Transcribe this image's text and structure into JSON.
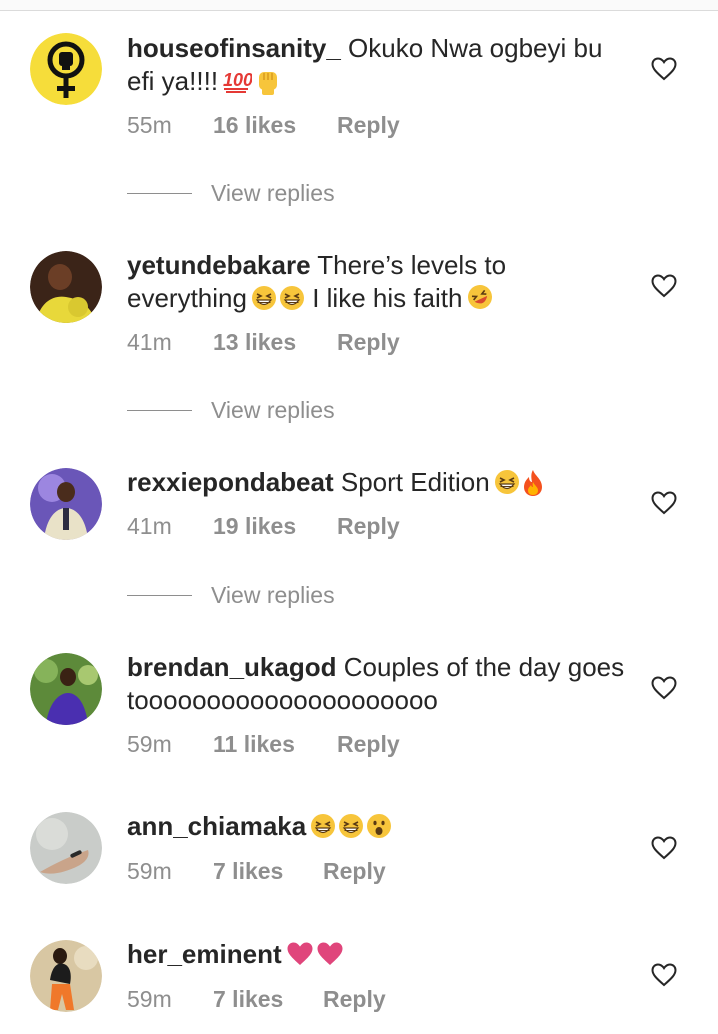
{
  "comments": [
    {
      "username": "houseofinsanity_",
      "text": " Okuko Nwa ogbeyi bu efi ya!!!!",
      "emojis": [
        "hundred-points-emoji",
        "raised-fist-emoji"
      ],
      "time": "55m",
      "likes": "16 likes",
      "reply": "Reply",
      "avatar_icon": "venus-fist-icon",
      "view_replies": "View replies"
    },
    {
      "username": "yetundebakare",
      "text": " There’s levels to everything",
      "emojis": [
        "grinning-squinting-emoji",
        "grinning-squinting-emoji"
      ],
      "text2": " I like his faith",
      "emojis2": [
        "rofl-emoji"
      ],
      "time": "41m",
      "likes": "13 likes",
      "reply": "Reply",
      "view_replies": "View replies"
    },
    {
      "username": "rexxiepondabeat",
      "text": " Sport Edition",
      "emojis": [
        "grinning-squinting-emoji",
        "fire-emoji"
      ],
      "time": "41m",
      "likes": "19 likes",
      "reply": "Reply",
      "view_replies": "View replies"
    },
    {
      "username": "brendan_ukagod",
      "text": " Couples of the day goes tooooooooooooooooooooo",
      "time": "59m",
      "likes": "11 likes",
      "reply": "Reply"
    },
    {
      "username": "ann_chiamaka",
      "emojis": [
        "grinning-squinting-emoji",
        "grinning-squinting-emoji",
        "surprised-emoji"
      ],
      "time": "59m",
      "likes": "7 likes",
      "reply": "Reply"
    },
    {
      "username": "her_eminent",
      "emojis": [
        "pink-heart-emoji",
        "pink-heart-emoji"
      ],
      "time": "59m",
      "likes": "7 likes",
      "reply": "Reply"
    }
  ],
  "colors": {
    "text": "#262626",
    "secondary": "#8e8e8e",
    "venus_yellow": "#f6dd3a",
    "heart_pink": "#e0457b"
  }
}
